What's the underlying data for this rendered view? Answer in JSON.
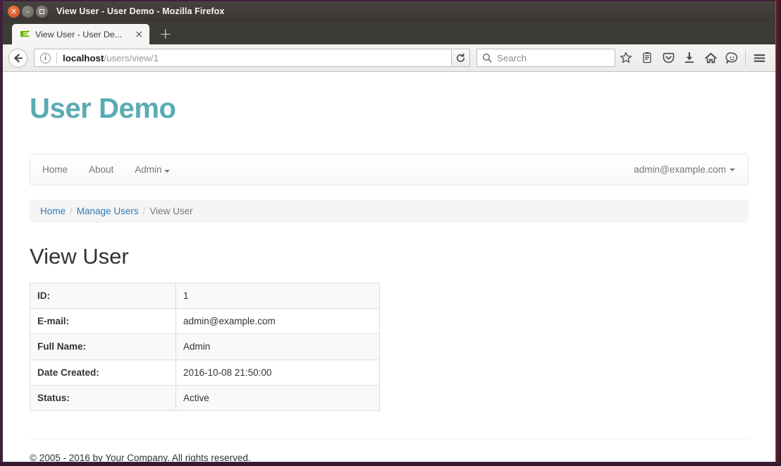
{
  "window": {
    "title": "View User - User Demo - Mozilla Firefox",
    "controls": {
      "close": "close-button",
      "minimize": "minimize-button",
      "maximize": "maximize-button"
    }
  },
  "browser": {
    "tab": {
      "title": "View User - User De...",
      "favicon": "zend-framework-favicon",
      "close_label": "×"
    },
    "new_tab_label": "+",
    "back_label": "←",
    "reload_label": "⟳",
    "url": {
      "host": "localhost",
      "path": "/users/view/1",
      "full": "localhost/users/view/1"
    },
    "search": {
      "placeholder": "Search",
      "value": ""
    },
    "toolbar_icons": [
      "bookmark-star-icon",
      "reading-list-icon",
      "pocket-icon",
      "downloads-icon",
      "home-icon",
      "sync-chat-icon",
      "hamburger-menu-icon"
    ]
  },
  "site": {
    "brand": "User Demo",
    "brand_color": "#5aabb4",
    "nav": {
      "links": [
        {
          "label": "Home"
        },
        {
          "label": "About"
        },
        {
          "label": "Admin",
          "has_caret": true
        }
      ],
      "user": {
        "label": "admin@example.com",
        "has_caret": true
      }
    },
    "breadcrumb": {
      "items": [
        {
          "label": "Home",
          "link": true
        },
        {
          "label": "Manage Users",
          "link": true
        },
        {
          "label": "View User",
          "link": false
        }
      ],
      "separator": "/"
    },
    "page_title": "View User",
    "table": {
      "rows": [
        {
          "key": "ID:",
          "value": "1"
        },
        {
          "key": "E-mail:",
          "value": "admin@example.com"
        },
        {
          "key": "Full Name:",
          "value": "Admin"
        },
        {
          "key": "Date Created:",
          "value": "2016-10-08 21:50:00"
        },
        {
          "key": "Status:",
          "value": "Active"
        }
      ]
    },
    "footer": "© 2005 - 2016 by Your Company. All rights reserved."
  }
}
